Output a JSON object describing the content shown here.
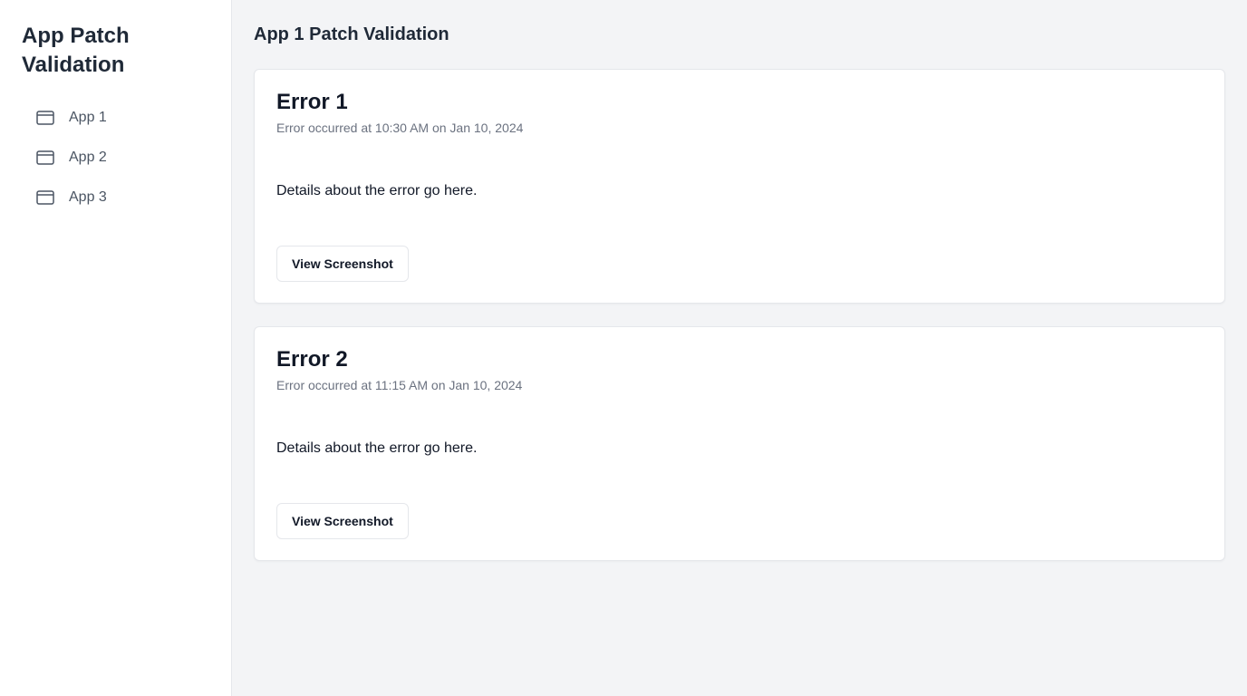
{
  "sidebar": {
    "title": "App Patch Validation",
    "items": [
      {
        "label": "App 1",
        "icon": "app-window-icon"
      },
      {
        "label": "App 2",
        "icon": "app-window-icon"
      },
      {
        "label": "App 3",
        "icon": "app-window-icon"
      }
    ]
  },
  "main": {
    "title": "App 1 Patch Validation",
    "errors": [
      {
        "title": "Error 1",
        "time": "Error occurred at 10:30 AM on Jan 10, 2024",
        "details": "Details about the error go here.",
        "button_label": "View Screenshot"
      },
      {
        "title": "Error 2",
        "time": "Error occurred at 11:15 AM on Jan 10, 2024",
        "details": "Details about the error go here.",
        "button_label": "View Screenshot"
      }
    ]
  },
  "colors": {
    "background": "#f3f4f6",
    "sidebar_background": "#ffffff",
    "muted_text": "#6b7280",
    "nav_text": "#4b5563"
  }
}
